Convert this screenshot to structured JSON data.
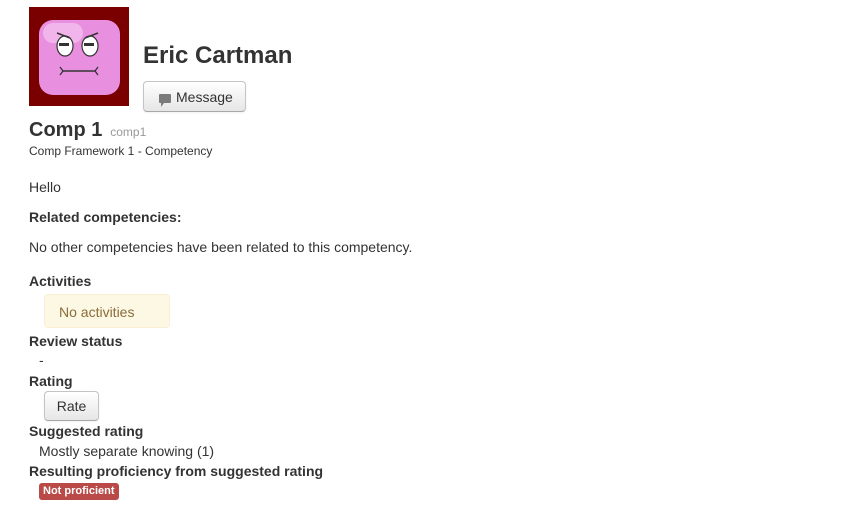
{
  "user": {
    "name": "Eric Cartman",
    "message_button_label": "Message"
  },
  "competency": {
    "name": "Comp 1",
    "idnumber": "comp1",
    "framework_path": "Comp Framework 1 - Competency",
    "description": "Hello"
  },
  "related": {
    "heading": "Related competencies:",
    "empty_text": "No other competencies have been related to this competency."
  },
  "activities": {
    "heading": "Activities",
    "empty_text": "No activities"
  },
  "review": {
    "heading": "Review status",
    "value": "-"
  },
  "rating": {
    "heading": "Rating",
    "rate_button_label": "Rate"
  },
  "suggested": {
    "heading": "Suggested rating",
    "value": "Mostly separate knowing (1)"
  },
  "proficiency": {
    "heading": "Resulting proficiency from suggested rating",
    "badge": "Not proficient"
  },
  "colors": {
    "avatar_background": "#7a0000",
    "avatar_face": "#e98fe0",
    "alert_background": "#fcf8e3",
    "alert_text": "#8a6d3b",
    "badge_danger": "#b94a48"
  }
}
